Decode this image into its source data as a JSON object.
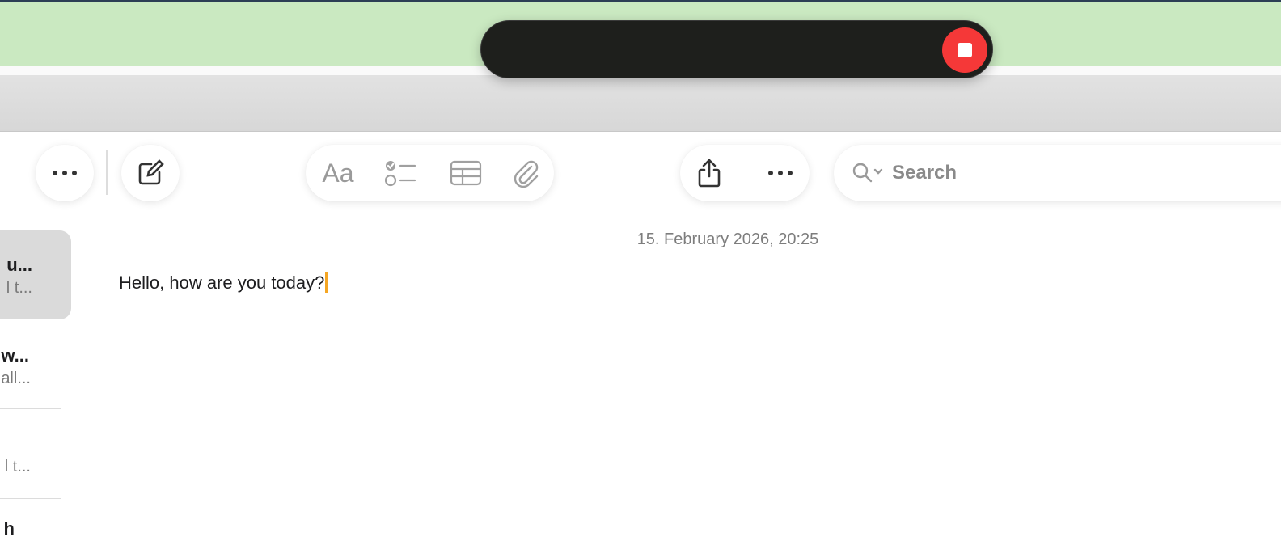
{
  "colors": {
    "green_band": "#cae9c1",
    "recorder_bg": "#1e1f1c",
    "stop_red": "#f53838",
    "caret": "#f5a623",
    "selected_item": "#dadada"
  },
  "recording": {
    "stop_icon": "stop-icon",
    "waveform_start_color": "#e05a5a",
    "waveform_end_color": "#6a55d6"
  },
  "toolbar": {
    "more_icon": "ellipsis-icon",
    "compose_icon": "compose-icon",
    "format_label": "Aa",
    "checklist_icon": "checklist-icon",
    "table_icon": "table-icon",
    "attach_icon": "paperclip-icon",
    "share_icon": "share-icon",
    "more2_icon": "ellipsis-icon"
  },
  "search": {
    "placeholder": "Search",
    "icon": "search-icon"
  },
  "sidebar": {
    "items": [
      {
        "title": "u...",
        "subtitle": "l t..."
      },
      {
        "title": "w...",
        "subtitle": "all..."
      },
      {
        "title": "",
        "subtitle": "l t..."
      },
      {
        "title": "h",
        "subtitle": ""
      }
    ]
  },
  "note": {
    "date": "15. February 2026, 20:25",
    "body": "Hello, how are you today?"
  }
}
